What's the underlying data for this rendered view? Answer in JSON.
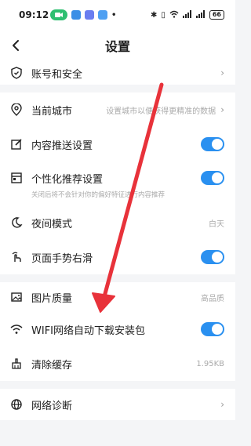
{
  "status_bar": {
    "time": "09:12",
    "battery": "66"
  },
  "header": {
    "title": "设置"
  },
  "items": {
    "account": {
      "label": "账号和安全"
    },
    "city": {
      "label": "当前城市",
      "value": "设置城市以便获得更精准的数据"
    },
    "push": {
      "label": "内容推送设置",
      "on": true
    },
    "personal": {
      "label": "个性化推荐设置",
      "sub": "关闭后将不会针对你的偏好特征进行内容推荐",
      "on": true
    },
    "night": {
      "label": "夜间模式",
      "value": "白天"
    },
    "gesture": {
      "label": "页面手势右滑",
      "on": true
    },
    "image": {
      "label": "图片质量",
      "value": "高品质"
    },
    "wifi": {
      "label": "WIFI网络自动下载安装包",
      "on": true
    },
    "cache": {
      "label": "清除缓存",
      "value": "1.95KB"
    },
    "network": {
      "label": "网络诊断"
    }
  },
  "colors": {
    "toggle_on": "#2a90f0",
    "annotation_arrow": "#e8323a",
    "call_pill": "#2fbf71"
  }
}
